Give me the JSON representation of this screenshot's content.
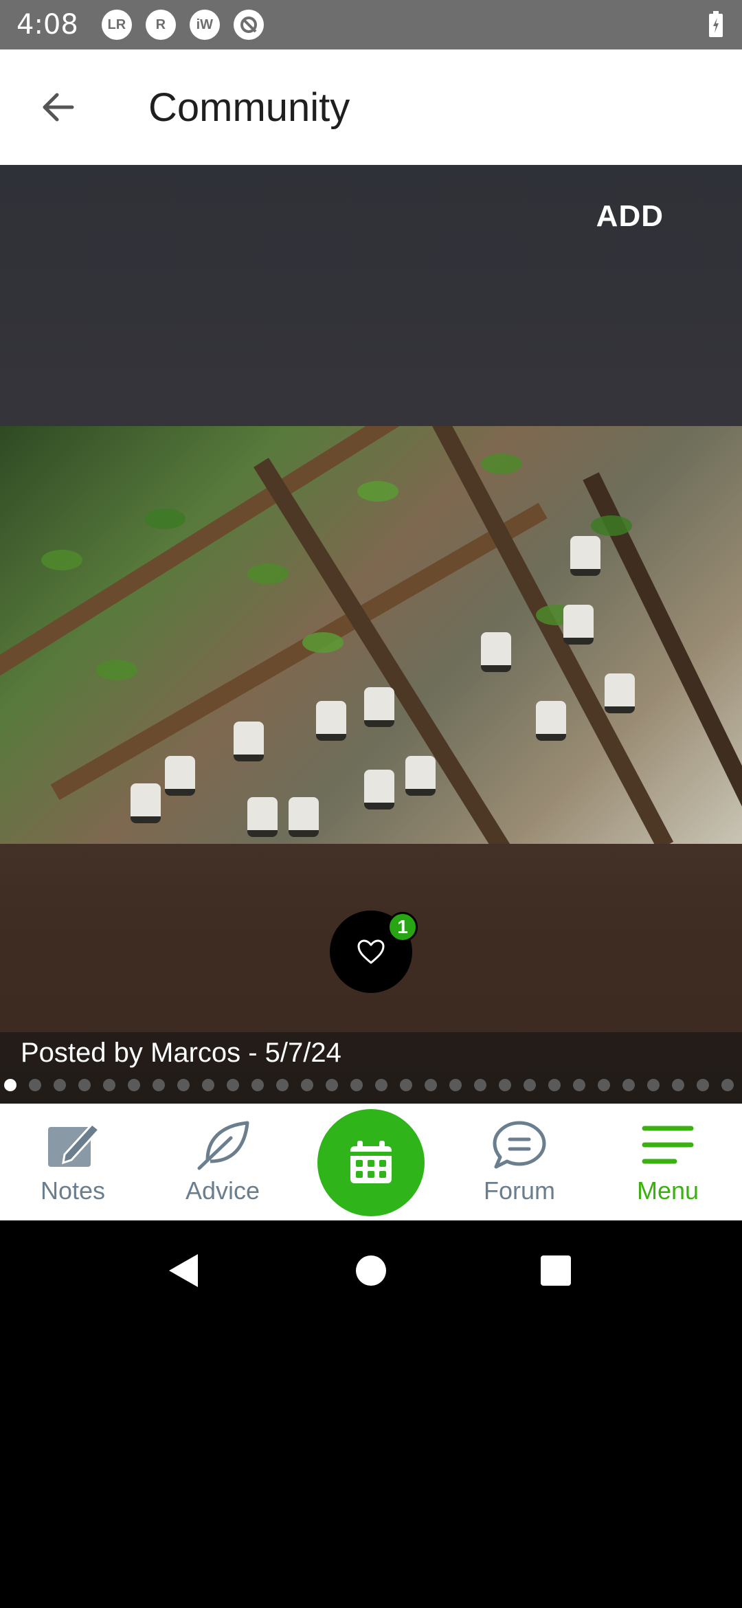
{
  "status_bar": {
    "time": "4:08",
    "icons": [
      {
        "name": "lr-icon",
        "text": "LR"
      },
      {
        "name": "r-icon",
        "text": "R"
      },
      {
        "name": "iw-icon",
        "text": "iW"
      },
      {
        "name": "q-icon",
        "text": ""
      }
    ]
  },
  "app_bar": {
    "title": "Community"
  },
  "content": {
    "add_label": "ADD",
    "like_count": "1",
    "caption": "Posted by Marcos - 5/7/24",
    "pagination": {
      "total": 30,
      "active": 0
    }
  },
  "bottom_nav": {
    "items": [
      {
        "label": "Notes",
        "icon": "notes-icon"
      },
      {
        "label": "Advice",
        "icon": "leaf-icon"
      },
      {
        "label": "",
        "icon": "calendar-icon"
      },
      {
        "label": "Forum",
        "icon": "chat-icon"
      },
      {
        "label": "Menu",
        "icon": "menu-icon"
      }
    ],
    "active_color": "#39b111",
    "inactive_color": "#6b7e8e"
  }
}
